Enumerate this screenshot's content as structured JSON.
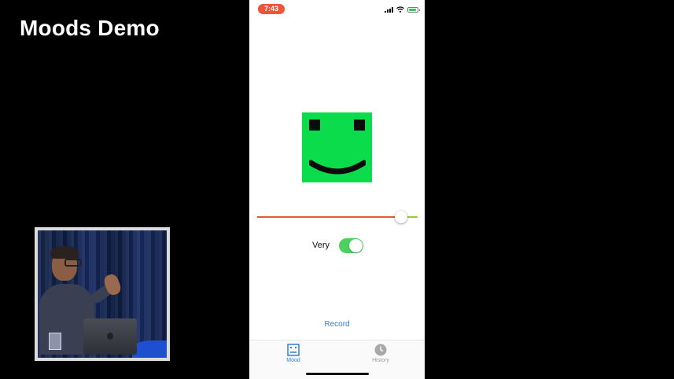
{
  "slide": {
    "title": "Moods Demo"
  },
  "status_bar": {
    "time": "7:43"
  },
  "mood": {
    "face": "smiling-face",
    "level": 0.93,
    "track_min_color": "#e45a2e",
    "track_max_color": "#8bd33a",
    "face_color": "#0bdc4b"
  },
  "intensity": {
    "label": "Very",
    "on": true
  },
  "actions": {
    "record_label": "Record"
  },
  "tabs": [
    {
      "label": "Mood",
      "icon": "face-icon",
      "selected": true
    },
    {
      "label": "History",
      "icon": "clock-icon",
      "selected": false
    }
  ],
  "colors": {
    "accent": "#2d7fd6",
    "time_pill": "#f0523a",
    "toggle_on": "#4cd15f"
  }
}
